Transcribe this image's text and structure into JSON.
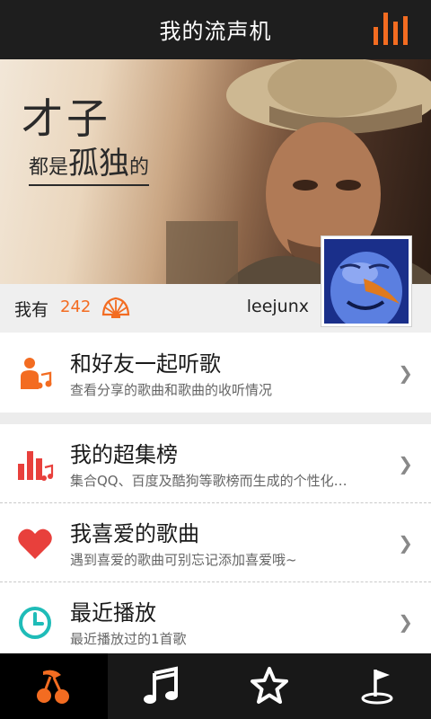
{
  "header": {
    "title": "我的流声机"
  },
  "banner": {
    "line1": "才子",
    "line2_pre": "都是",
    "line2_big": "孤独",
    "line2_post": "的"
  },
  "user": {
    "have_label": "我有",
    "shell_count": "242",
    "username": "leejunx"
  },
  "menu": [
    {
      "title": "和好友一起听歌",
      "subtitle": "查看分享的歌曲和歌曲的收听情况",
      "icon": "listen-with-friends-icon"
    },
    {
      "title": "我的超集榜",
      "subtitle": "集合QQ、百度及酷狗等歌榜而生成的个性化…",
      "icon": "chart-bars-icon"
    },
    {
      "title": "我喜爱的歌曲",
      "subtitle": "遇到喜爱的歌曲可别忘记添加喜爱哦~",
      "icon": "heart-icon"
    },
    {
      "title": "最近播放",
      "subtitle": "最近播放过的1首歌",
      "icon": "clock-icon"
    }
  ],
  "chevron": "❯",
  "tabs": [
    {
      "icon": "music-cherry-icon",
      "active": true
    },
    {
      "icon": "music-note-icon",
      "active": false
    },
    {
      "icon": "star-icon",
      "active": false
    },
    {
      "icon": "flag-hole-icon",
      "active": false
    }
  ],
  "colors": {
    "accent": "#f36c21",
    "red": "#e8403c",
    "teal": "#1fbcb8",
    "header_bg": "#1e1e1e"
  }
}
